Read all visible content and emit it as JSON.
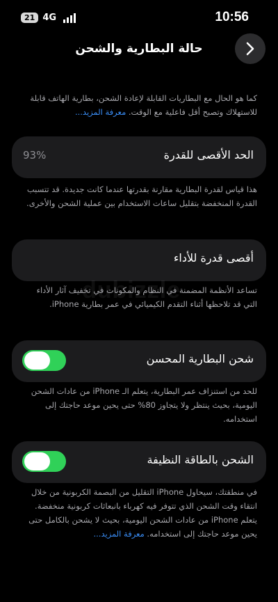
{
  "status_bar": {
    "battery_level": "21",
    "network": "4G",
    "time": "10:56"
  },
  "nav": {
    "title": "حالة البطارية والشحن",
    "back_icon": "chevron-right-icon"
  },
  "intro": {
    "text": "كما هو الحال مع البطاريات القابلة لإعادة الشحن، بطارية الهاتف قابلة للاستهلاك وتصبح أقل فاعلية مع الوقت.",
    "link": "معرفة المزيد..."
  },
  "max_capacity": {
    "label": "الحد الأقصى للقدرة",
    "value": "93%",
    "description": "هذا قياس لقدرة البطارية مقارنة بقدرتها عندما كانت جديدة. قد تتسبب القدرة المنخفضة بتقليل ساعات الاستخدام بين عملية الشحن والأخرى."
  },
  "peak_performance": {
    "label": "أقصى قدرة للأداء",
    "description": "تساعد الأنظمة المضمنة في النظام والمكونات في تخفيف آثار الأداء التي قد تلاحظها أثناء التقدم الكيميائي في عمر بطارية iPhone."
  },
  "optimized_charging": {
    "label": "شحن البطارية المحسن",
    "enabled": true,
    "description": "للحد من استنزاف عمر البطارية، يتعلم الـ iPhone من عادات الشحن اليومية، بحيث ينتظر ولا يتجاوز 80% حتى يحين موعد حاجتك إلى استخدامه."
  },
  "clean_energy": {
    "label": "الشحن بالطاقة النظيفة",
    "enabled": true,
    "description": "في منطقتك، سيحاول iPhone التقليل من البصمة الكربونية من خلال انتقاء وقت الشحن الذي تتوفر فيه كهرباء بانبعاثات كربونية منخفضة. يتعلم iPhone من عادات الشحن اليومية، بحيث لا يشحن بالكامل حتى يحين موعد حاجتك إلى استخدامه.",
    "link": "معرفة المزيد..."
  },
  "watermark": "dubizzle",
  "colors": {
    "background": "#000000",
    "card": "#1c1c1e",
    "toggle_on": "#30d158",
    "link": "#3a8ef7",
    "secondary_text": "#a8a8ad"
  }
}
